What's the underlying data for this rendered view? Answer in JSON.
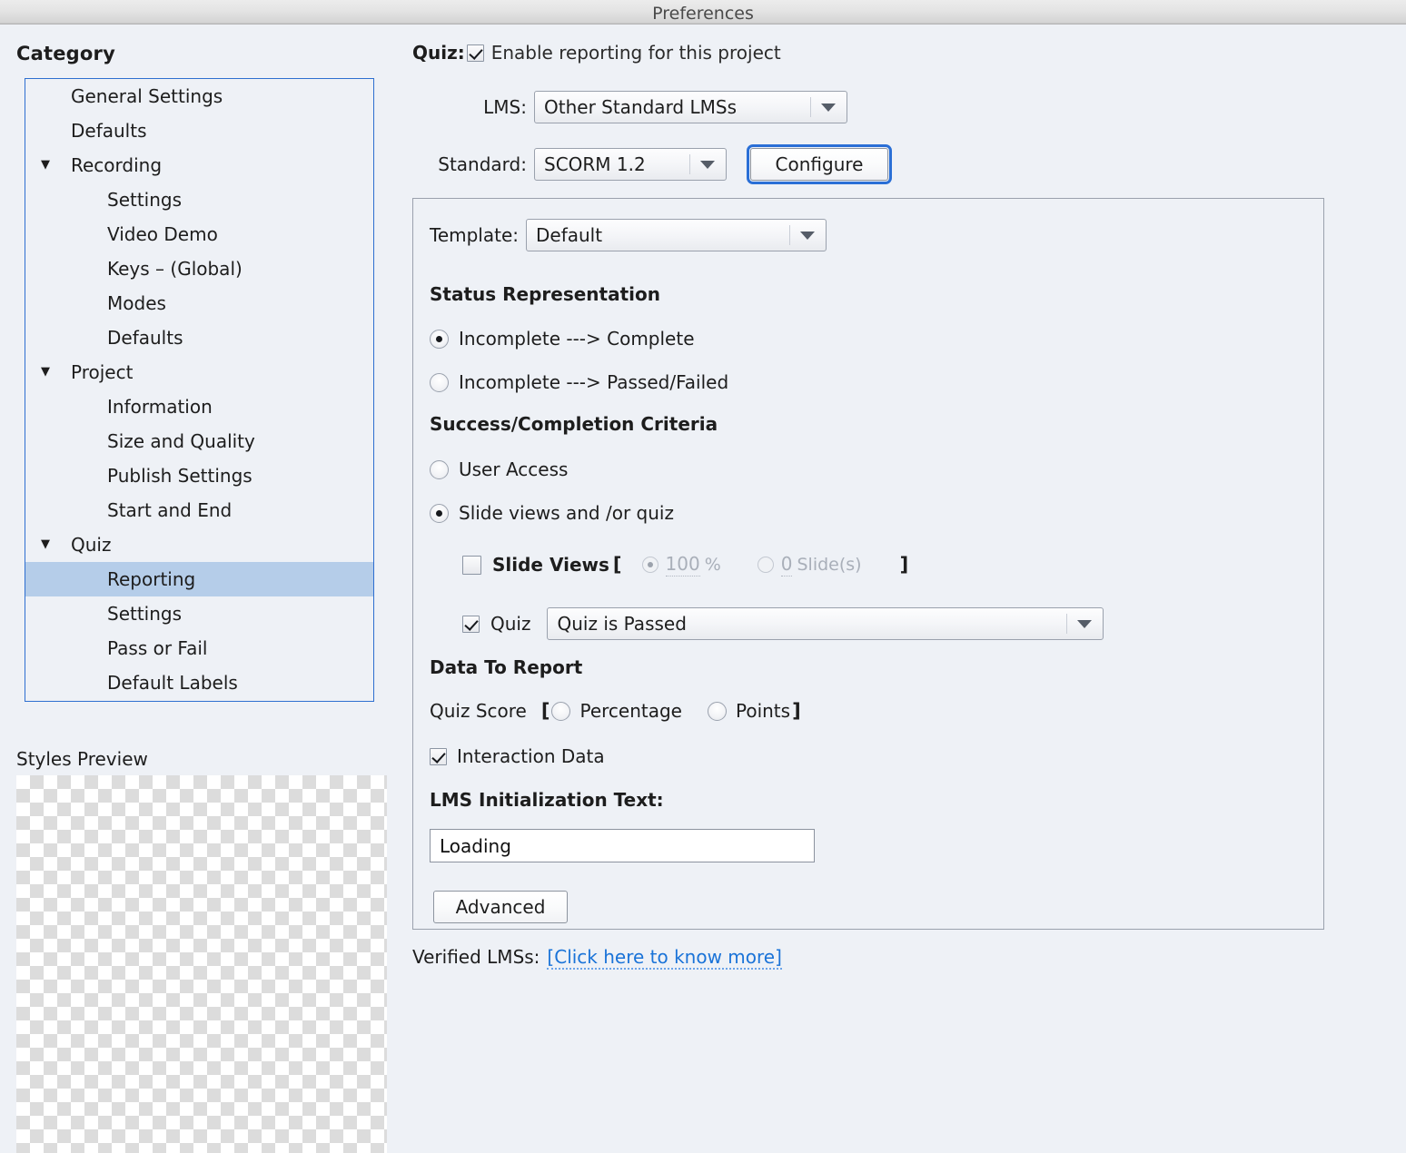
{
  "window": {
    "title": "Preferences"
  },
  "sidebar": {
    "heading": "Category",
    "items": [
      {
        "label": "General Settings",
        "level": 1,
        "disclosure": "",
        "selected": false
      },
      {
        "label": "Defaults",
        "level": 1,
        "disclosure": "",
        "selected": false
      },
      {
        "label": "Recording",
        "level": 1,
        "disclosure": "▼",
        "selected": false
      },
      {
        "label": "Settings",
        "level": 2,
        "disclosure": "",
        "selected": false
      },
      {
        "label": "Video Demo",
        "level": 2,
        "disclosure": "",
        "selected": false
      },
      {
        "label": "Keys – (Global)",
        "level": 2,
        "disclosure": "",
        "selected": false
      },
      {
        "label": "Modes",
        "level": 2,
        "disclosure": "",
        "selected": false
      },
      {
        "label": "Defaults",
        "level": 2,
        "disclosure": "",
        "selected": false
      },
      {
        "label": "Project",
        "level": 1,
        "disclosure": "▼",
        "selected": false
      },
      {
        "label": "Information",
        "level": 2,
        "disclosure": "",
        "selected": false
      },
      {
        "label": "Size and Quality",
        "level": 2,
        "disclosure": "",
        "selected": false
      },
      {
        "label": "Publish Settings",
        "level": 2,
        "disclosure": "",
        "selected": false
      },
      {
        "label": "Start and End",
        "level": 2,
        "disclosure": "",
        "selected": false
      },
      {
        "label": "Quiz",
        "level": 1,
        "disclosure": "▼",
        "selected": false
      },
      {
        "label": "Reporting",
        "level": 2,
        "disclosure": "",
        "selected": true
      },
      {
        "label": "Settings",
        "level": 2,
        "disclosure": "",
        "selected": false
      },
      {
        "label": "Pass or Fail",
        "level": 2,
        "disclosure": "",
        "selected": false
      },
      {
        "label": "Default Labels",
        "level": 2,
        "disclosure": "",
        "selected": false
      }
    ],
    "styles_preview_label": "Styles Preview"
  },
  "main": {
    "quiz_label": "Quiz:",
    "enable_reporting_label": "Enable reporting for this project",
    "enable_reporting_checked": true,
    "lms_label": "LMS:",
    "lms_value": "Other Standard LMSs",
    "standard_label": "Standard:",
    "standard_value": "SCORM 1.2",
    "configure_label": "Configure",
    "template_label": "Template:",
    "template_value": "Default",
    "status_representation_heading": "Status Representation",
    "status_options": [
      {
        "label": "Incomplete ---> Complete",
        "selected": true
      },
      {
        "label": "Incomplete ---> Passed/Failed",
        "selected": false
      }
    ],
    "success_criteria_heading": "Success/Completion Criteria",
    "criteria_options": [
      {
        "label": "User Access",
        "selected": false
      },
      {
        "label": "Slide views and /or quiz",
        "selected": true
      }
    ],
    "slide_views_label": "Slide Views",
    "slide_views_checked": false,
    "bracket_open": "[",
    "bracket_close": "]",
    "percent_value": "100",
    "percent_unit": "%",
    "percent_selected": true,
    "slides_value": "0",
    "slides_unit": "Slide(s)",
    "slides_selected": false,
    "quiz_check_label": "Quiz",
    "quiz_check_checked": true,
    "quiz_condition_value": "Quiz is Passed",
    "data_to_report_heading": "Data To Report",
    "quiz_score_label": "Quiz Score",
    "score_options": [
      {
        "label": "Percentage",
        "selected": true
      },
      {
        "label": "Points",
        "selected": false
      }
    ],
    "interaction_data_label": "Interaction Data",
    "interaction_data_checked": true,
    "lms_init_heading": "LMS Initialization Text:",
    "lms_init_value": "Loading",
    "advanced_label": "Advanced",
    "verified_lms_label": "Verified LMSs:",
    "verified_lms_link": "[Click here to know more]"
  },
  "colors": {
    "selection": "#b5cde9",
    "focus_ring": "#2a6fd6",
    "link": "#1a73d8",
    "window_bg": "#eef1f6"
  }
}
